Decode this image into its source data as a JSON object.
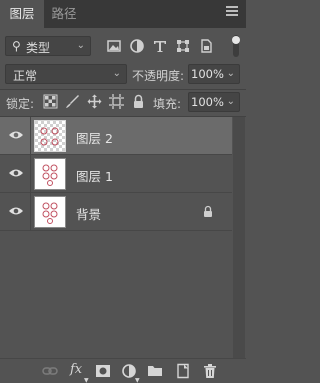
{
  "tabs": [
    {
      "label": "图层",
      "active": true
    },
    {
      "label": "路径",
      "active": false
    }
  ],
  "filter": {
    "label": "类型",
    "icons": [
      "image-filter-icon",
      "adjustment-filter-icon",
      "type-filter-icon",
      "shape-filter-icon",
      "smart-object-filter-icon"
    ]
  },
  "blend": {
    "mode": "正常",
    "opacity_label": "不透明度:",
    "opacity_value": "100%"
  },
  "lock": {
    "label": "锁定:",
    "fill_label": "填充:",
    "fill_value": "100%"
  },
  "layers": [
    {
      "name": "图层 2",
      "visible": true,
      "selected": true,
      "locked": false
    },
    {
      "name": "图层 1",
      "visible": true,
      "selected": false,
      "locked": false
    },
    {
      "name": "背景",
      "visible": true,
      "selected": false,
      "locked": true
    }
  ],
  "colors": {
    "panel_bg": "#535353",
    "tab_bar_bg": "#383838",
    "selected_row": "#6b6b6b",
    "thumbnail_mark": "#c05060"
  },
  "bottom_toolbar": {
    "fx_label": "fx",
    "icons": [
      "link-layers-icon",
      "layer-style-icon",
      "layer-mask-icon",
      "adjustment-layer-icon",
      "group-folder-icon",
      "new-layer-icon",
      "trash-icon"
    ]
  }
}
